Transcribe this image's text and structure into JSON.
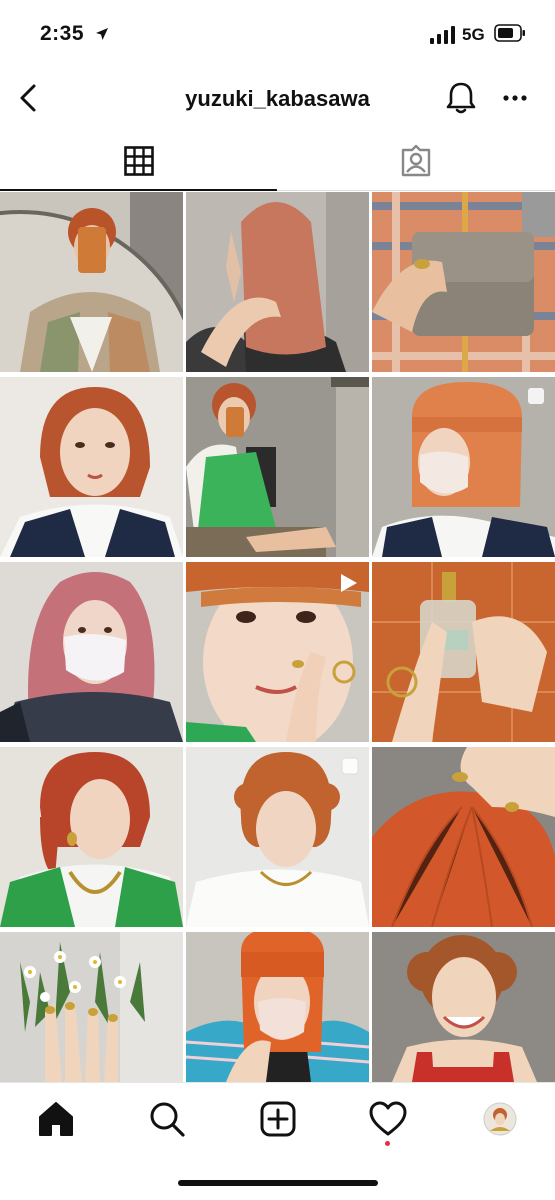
{
  "status": {
    "time": "2:35",
    "network": "5G"
  },
  "header": {
    "username": "yuzuki_kabasawa"
  },
  "tabs": [
    "grid",
    "tagged"
  ],
  "posts": [
    {
      "row": 0,
      "col": 0,
      "scene": "mirror selfie, plaid jacket, orange phone",
      "badge": "none"
    },
    {
      "row": 0,
      "col": 1,
      "scene": "back view, pink-orange straight hair",
      "badge": "none"
    },
    {
      "row": 0,
      "col": 2,
      "scene": "hand holding gray wallet",
      "badge": "none"
    },
    {
      "row": 1,
      "col": 0,
      "scene": "portrait, orange wavy bob, navy vest",
      "badge": "none"
    },
    {
      "row": 1,
      "col": 1,
      "scene": "mirror selfie, green dress",
      "badge": "none"
    },
    {
      "row": 1,
      "col": 2,
      "scene": "profile, orange bob, face mask",
      "badge": "multi"
    },
    {
      "row": 2,
      "col": 0,
      "scene": "pink hair, face mask",
      "badge": "none"
    },
    {
      "row": 2,
      "col": 1,
      "scene": "close-up face, orange fringe",
      "badge": "video"
    },
    {
      "row": 2,
      "col": 2,
      "scene": "hands holding perfume bottle",
      "badge": "none"
    },
    {
      "row": 3,
      "col": 0,
      "scene": "side profile, green vest, chain necklace",
      "badge": "none"
    },
    {
      "row": 3,
      "col": 1,
      "scene": "curly orange short hair, white blouse",
      "badge": "multi"
    },
    {
      "row": 3,
      "col": 2,
      "scene": "top of head, orange hair, hand",
      "badge": "none"
    },
    {
      "row": 4,
      "col": 0,
      "scene": "hand with white flowers",
      "badge": "none"
    },
    {
      "row": 4,
      "col": 1,
      "scene": "orange bob, striped shirt, mask",
      "badge": "none"
    },
    {
      "row": 4,
      "col": 2,
      "scene": "smiling, curly hair, red overalls",
      "badge": "none"
    }
  ],
  "nav": [
    "home",
    "search",
    "new-post",
    "activity",
    "profile"
  ],
  "colors": {
    "accent": "#111111",
    "notify_dot": "#e03040"
  }
}
